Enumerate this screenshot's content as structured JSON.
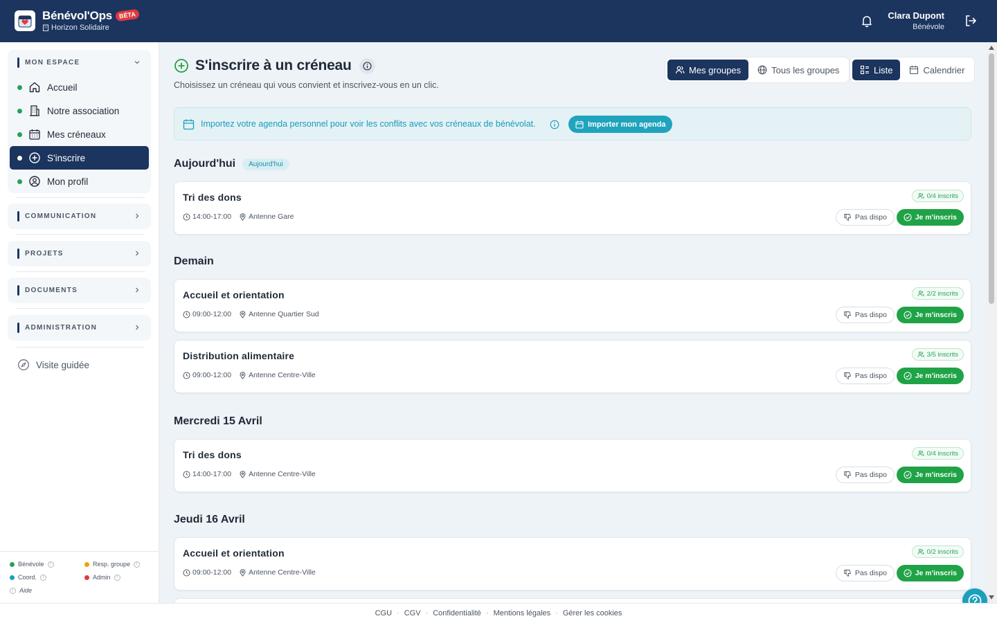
{
  "app": {
    "name": "Bénévol'Ops",
    "badge": "BÉTA",
    "org": "Horizon Solidaire"
  },
  "user": {
    "name": "Clara Dupont",
    "role": "Bénévole"
  },
  "sidebar": {
    "sections": [
      {
        "title": "MON ESPACE",
        "expanded": true
      },
      {
        "title": "COMMUNICATION"
      },
      {
        "title": "PROJETS"
      },
      {
        "title": "DOCUMENTS"
      },
      {
        "title": "ADMINISTRATION"
      }
    ],
    "items": [
      {
        "label": "Accueil",
        "icon": "home-icon"
      },
      {
        "label": "Notre association",
        "icon": "building-icon"
      },
      {
        "label": "Mes créneaux",
        "icon": "calendar-icon"
      },
      {
        "label": "S'inscrire",
        "icon": "plus-circle-icon",
        "active": true
      },
      {
        "label": "Mon profil",
        "icon": "user-circle-icon"
      }
    ],
    "guide": "Visite guidée",
    "legend": {
      "benevole": "Bénévole",
      "resp": "Resp. groupe",
      "coord": "Coord.",
      "admin": "Admin",
      "aide": "Aide"
    },
    "legend_colors": {
      "benevole": "#22a35a",
      "resp": "#f59e0b",
      "coord": "#1aa0bd",
      "admin": "#e03a3e"
    }
  },
  "page": {
    "title": "S'inscrire à un créneau",
    "subtitle": "Choisissez un créneau qui vous convient et inscrivez-vous en un clic.",
    "scope_tabs": [
      "Mes groupes",
      "Tous les groupes"
    ],
    "view_tabs": [
      "Liste",
      "Calendrier"
    ]
  },
  "banner": {
    "text": "Importez votre agenda personnel pour voir les conflits avec vos créneaux de bénévolat.",
    "button": "Importer mon agenda"
  },
  "days": [
    {
      "label": "Aujourd'hui",
      "badge": "Aujourd'hui"
    },
    {
      "label": "Demain"
    },
    {
      "label": "Mercredi 15 Avril"
    },
    {
      "label": "Jeudi 16 Avril"
    }
  ],
  "slots": [
    {
      "title": "Tri des dons",
      "time": "14:00-17:00",
      "place": "Antenne Gare",
      "count": "0/4 inscrits"
    },
    {
      "title": "Accueil et orientation",
      "time": "09:00-12:00",
      "place": "Antenne Quartier Sud",
      "count": "2/2 inscrits"
    },
    {
      "title": "Distribution alimentaire",
      "time": "09:00-12:00",
      "place": "Antenne Centre-Ville",
      "count": "3/5 inscrits"
    },
    {
      "title": "Tri des dons",
      "time": "14:00-17:00",
      "place": "Antenne Centre-Ville",
      "count": "0/4 inscrits"
    },
    {
      "title": "Accueil et orientation",
      "time": "09:00-12:00",
      "place": "Antenne Centre-Ville",
      "count": "0/2 inscrits"
    }
  ],
  "actions": {
    "decline": "Pas dispo",
    "accept": "Je m'inscris"
  },
  "footer": [
    "CGU",
    "CGV",
    "Confidentialité",
    "Mentions légales",
    "Gérer les cookies"
  ],
  "colors": {
    "navy": "#1c355e",
    "green": "#1fa346",
    "teal": "#1aa0bd"
  }
}
